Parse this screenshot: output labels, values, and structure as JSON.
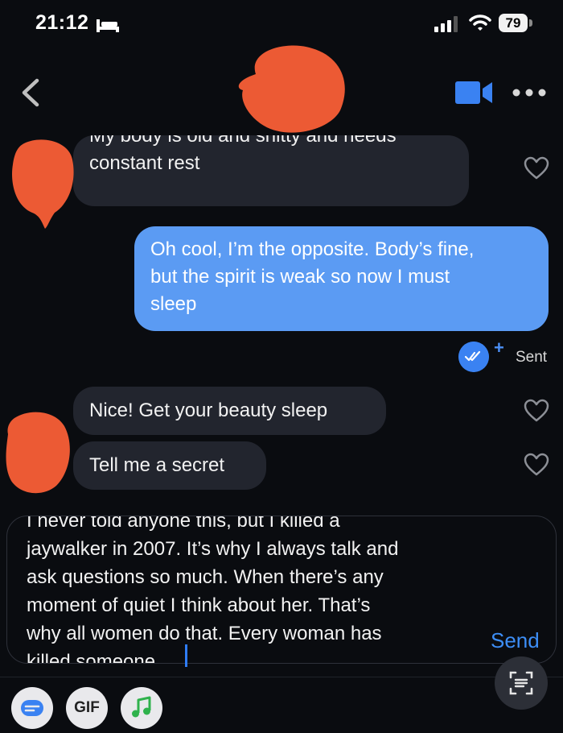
{
  "status_bar": {
    "time": "21:12",
    "battery": "79"
  },
  "messages": [
    {
      "id": 1,
      "direction": "incoming",
      "lines": [
        "My body is old and shitty and needs",
        "constant rest"
      ]
    },
    {
      "id": 2,
      "direction": "outgoing",
      "lines": [
        "Oh cool, I’m the opposite. Body’s fine,",
        "but the spirit is weak so now I must",
        "sleep"
      ]
    },
    {
      "id": 3,
      "direction": "incoming",
      "lines": [
        "Nice! Get your beauty sleep"
      ]
    },
    {
      "id": 4,
      "direction": "incoming",
      "lines": [
        "Tell me a secret"
      ]
    }
  ],
  "receipt": {
    "plus": "+",
    "sent_label": "Sent"
  },
  "composer": {
    "text": "I never told anyone this, but I killed a\njaywalker in 2007. It’s why I always talk and\nask questions so much. When there’s any\nmoment of quiet I think about her. That’s\nwhy all women do that. Every woman has\nkilled someone",
    "send_label": "Send"
  },
  "toolbar": {
    "gif_label": "GIF"
  },
  "colors": {
    "accent": "#5b9bf3",
    "incoming_bubble": "#22252e",
    "redaction": "#ec5a34",
    "background": "#0a0c10"
  },
  "icons": [
    "bed-icon",
    "signal-icon",
    "wifi-icon",
    "back-chevron-icon",
    "video-camera-icon",
    "more-dots-icon",
    "heart-icon",
    "double-check-icon",
    "scan-text-icon",
    "sticker-icon",
    "music-note-icon"
  ]
}
